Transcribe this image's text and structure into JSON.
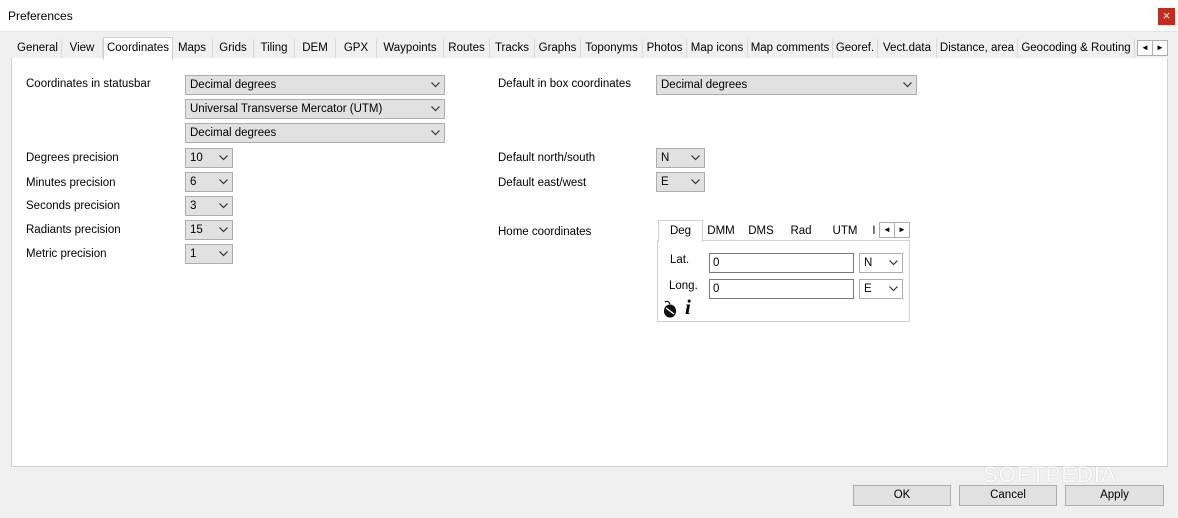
{
  "window": {
    "title": "Preferences",
    "close_glyph": "×"
  },
  "tabs": [
    {
      "label": "General"
    },
    {
      "label": "View"
    },
    {
      "label": "Coordinates",
      "active": true
    },
    {
      "label": "Maps"
    },
    {
      "label": "Grids"
    },
    {
      "label": "Tiling"
    },
    {
      "label": "DEM"
    },
    {
      "label": "GPX"
    },
    {
      "label": "Waypoints"
    },
    {
      "label": "Routes"
    },
    {
      "label": "Tracks"
    },
    {
      "label": "Graphs"
    },
    {
      "label": "Toponyms"
    },
    {
      "label": "Photos"
    },
    {
      "label": "Map icons"
    },
    {
      "label": "Map comments"
    },
    {
      "label": "Georef."
    },
    {
      "label": "Vect.data"
    },
    {
      "label": "Distance, area"
    },
    {
      "label": "Geocoding & Routing"
    }
  ],
  "arrows": {
    "left": "◄",
    "right": "►"
  },
  "left": {
    "statusbar_label": "Coordinates in statusbar",
    "statusbar_1": "Decimal degrees",
    "statusbar_2": "Universal Transverse Mercator (UTM)",
    "statusbar_3": "Decimal degrees",
    "degrees_label": "Degrees precision",
    "degrees_value": "10",
    "minutes_label": "Minutes precision",
    "minutes_value": "6",
    "seconds_label": "Seconds precision",
    "seconds_value": "3",
    "radiants_label": "Radiants precision",
    "radiants_value": "15",
    "metric_label": "Metric precision",
    "metric_value": "1"
  },
  "right": {
    "inbox_label": "Default in box coordinates",
    "inbox_value": "Decimal degrees",
    "ns_label": "Default north/south",
    "ns_value": "N",
    "ew_label": "Default east/west",
    "ew_value": "E",
    "home_label": "Home coordinates"
  },
  "home": {
    "tabs": [
      {
        "label": "Deg",
        "active": true
      },
      {
        "label": "DMM"
      },
      {
        "label": "DMS"
      },
      {
        "label": "Rad"
      },
      {
        "label": "UTM"
      },
      {
        "label": "I"
      }
    ],
    "lat_label": "Lat.",
    "lat_value": "0",
    "lat_hemi": "N",
    "long_label": "Long.",
    "long_value": "0",
    "long_hemi": "E",
    "info_glyph": "i"
  },
  "buttons": {
    "ok": "OK",
    "cancel": "Cancel",
    "apply": "Apply"
  },
  "watermark": "SOFTPEDIA"
}
